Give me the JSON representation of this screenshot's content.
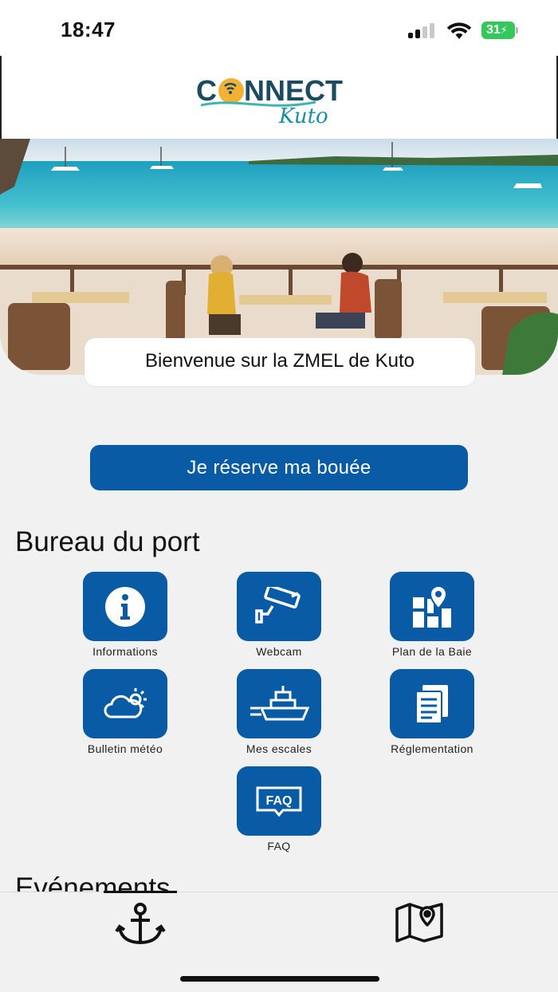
{
  "status_bar": {
    "time": "18:47",
    "battery": "31"
  },
  "header": {
    "logo_main": "CONNECT",
    "logo_sub": "Kuto"
  },
  "hero": {
    "welcome": "Bienvenue sur la ZMEL de Kuto"
  },
  "cta": {
    "label": "Je réserve ma bouée"
  },
  "bureau": {
    "title": "Bureau du port",
    "tiles": [
      {
        "label": "Informations",
        "icon": "info-icon"
      },
      {
        "label": "Webcam",
        "icon": "webcam-icon"
      },
      {
        "label": "Plan de la Baie",
        "icon": "map-pin-icon"
      },
      {
        "label": "Bulletin météo",
        "icon": "weather-icon"
      },
      {
        "label": "Mes escales",
        "icon": "ship-icon"
      },
      {
        "label": "Réglementation",
        "icon": "document-icon"
      },
      {
        "label": "FAQ",
        "icon": "faq-icon"
      }
    ]
  },
  "events": {
    "title": "Evénements"
  },
  "tab_bar": {
    "items": [
      {
        "icon": "anchor-icon",
        "active": true
      },
      {
        "icon": "map-icon",
        "active": false
      }
    ]
  },
  "colors": {
    "primary": "#0a5ba5",
    "battery": "#34c759"
  }
}
